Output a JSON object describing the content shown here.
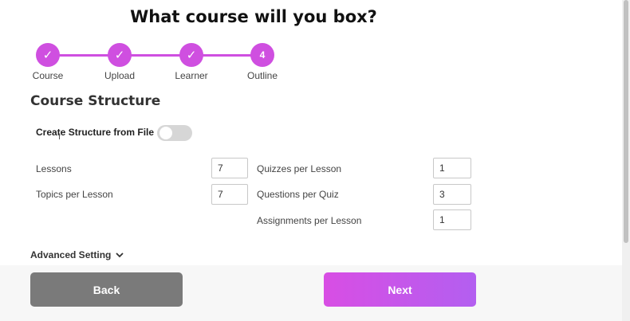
{
  "header": {
    "title": "What course will you box?"
  },
  "stepper": {
    "accent": "#cf4fe0",
    "steps": [
      {
        "label": "Course",
        "status": "done",
        "marker": "✓"
      },
      {
        "label": "Upload",
        "status": "done",
        "marker": "✓"
      },
      {
        "label": "Learner",
        "status": "done",
        "marker": "✓"
      },
      {
        "label": "Outline",
        "status": "current",
        "marker": "4"
      }
    ]
  },
  "section": {
    "title": "Course Structure"
  },
  "toggle": {
    "label": "Create Structure from File",
    "enabled": false
  },
  "fields": {
    "lessons": {
      "label": "Lessons",
      "value": "7"
    },
    "topics_per_lesson": {
      "label": "Topics per Lesson",
      "value": "7"
    },
    "quizzes_per_lesson": {
      "label": "Quizzes per Lesson",
      "value": "1"
    },
    "questions_per_quiz": {
      "label": "Questions per Quiz",
      "value": "3"
    },
    "assignments_per_lesson": {
      "label": "Assignments per Lesson",
      "value": "1"
    }
  },
  "advanced": {
    "label": "Advanced Setting"
  },
  "footer": {
    "back_label": "Back",
    "next_label": "Next"
  }
}
